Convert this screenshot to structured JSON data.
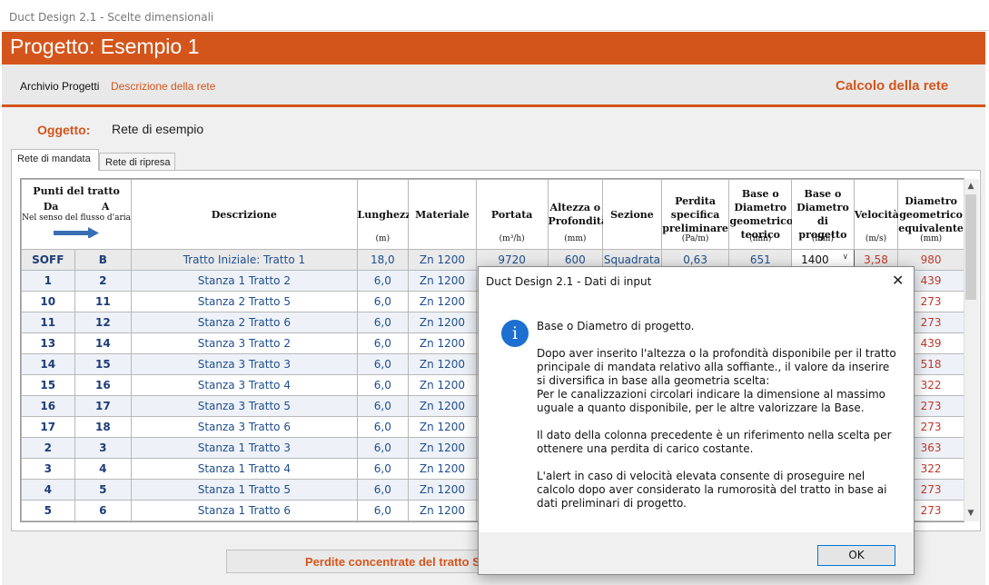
{
  "window": {
    "title": "Duct Design 2.1 - Scelte dimensionali"
  },
  "project": {
    "title": "Progetto: Esempio 1"
  },
  "menu": {
    "archivio": "Archivio Progetti",
    "descrizione": "Descrizione della rete",
    "calcolo": "Calcolo della rete"
  },
  "oggetto": {
    "label": "Oggetto:",
    "value": "Rete di esempio"
  },
  "tabs": [
    {
      "label": "Rete di mandata"
    },
    {
      "label": "Rete di ripresa"
    }
  ],
  "grid": {
    "headers": {
      "punti": "Punti del tratto",
      "da": "Da",
      "a": "A",
      "flusso": "Nel senso del flusso d'aria",
      "descrizione": "Descrizione",
      "lunghezza": "Lunghezza",
      "materiale": "Materiale",
      "portata": "Portata",
      "altezza_1": "Altezza o",
      "altezza_2": "Profondità",
      "sezione": "Sezione",
      "perdita_1": "Perdita",
      "perdita_2": "specifica",
      "perdita_3": "preliminare",
      "bdt_1": "Base o",
      "bdt_2": "Diametro",
      "bdt_3": "geometrico",
      "bdt_4": "teorico",
      "bdp_1": "Base o",
      "bdp_2": "Diametro",
      "bdp_3": "di progetto",
      "velocita": "Velocità",
      "deq_1": "Diametro",
      "deq_2": "geometrico",
      "deq_3": "equivalente"
    },
    "units": {
      "lunghezza": "(m)",
      "portata": "(m³/h)",
      "altezza": "(mm)",
      "perdita": "(Pa/m)",
      "bdt": "(mm)",
      "bdp": "(mm)",
      "velocita": "(m/s)",
      "deq": "(mm)"
    },
    "rows": [
      {
        "da": "SOFF",
        "a": "B",
        "descrizione": "Tratto Iniziale: Tratto 1",
        "lunghezza": "18,0",
        "materiale": "Zn 1200",
        "portata": "9720",
        "altezza": "600",
        "sezione": "Squadrata",
        "perdita": "0,63",
        "bdt": "651",
        "bdp": "1400",
        "velocita": "3,58",
        "deq": "980"
      },
      {
        "da": "1",
        "a": "2",
        "descrizione": "Stanza 1 Tratto 2",
        "lunghezza": "6,0",
        "materiale": "Zn 1200",
        "deq": "439"
      },
      {
        "da": "10",
        "a": "11",
        "descrizione": "Stanza 2 Tratto 5",
        "lunghezza": "6,0",
        "materiale": "Zn 1200",
        "deq": "273"
      },
      {
        "da": "11",
        "a": "12",
        "descrizione": "Stanza 2 Tratto 6",
        "lunghezza": "6,0",
        "materiale": "Zn 1200",
        "deq": "273"
      },
      {
        "da": "13",
        "a": "14",
        "descrizione": "Stanza 3 Tratto 2",
        "lunghezza": "6,0",
        "materiale": "Zn 1200",
        "deq": "439"
      },
      {
        "da": "14",
        "a": "15",
        "descrizione": "Stanza 3 Tratto 3",
        "lunghezza": "6,0",
        "materiale": "Zn 1200",
        "deq": "518"
      },
      {
        "da": "15",
        "a": "16",
        "descrizione": "Stanza 3 Tratto 4",
        "lunghezza": "6,0",
        "materiale": "Zn 1200",
        "deq": "322"
      },
      {
        "da": "16",
        "a": "17",
        "descrizione": "Stanza 3 Tratto 5",
        "lunghezza": "6,0",
        "materiale": "Zn 1200",
        "deq": "273"
      },
      {
        "da": "17",
        "a": "18",
        "descrizione": "Stanza 3 Tratto 6",
        "lunghezza": "6,0",
        "materiale": "Zn 1200",
        "deq": "273"
      },
      {
        "da": "2",
        "a": "3",
        "descrizione": "Stanza 1 Tratto 3",
        "lunghezza": "6,0",
        "materiale": "Zn 1200",
        "deq": "363"
      },
      {
        "da": "3",
        "a": "4",
        "descrizione": "Stanza 1 Tratto 4",
        "lunghezza": "6,0",
        "materiale": "Zn 1200",
        "deq": "322"
      },
      {
        "da": "4",
        "a": "5",
        "descrizione": "Stanza 1 Tratto 5",
        "lunghezza": "6,0",
        "materiale": "Zn 1200",
        "deq": "273"
      },
      {
        "da": "5",
        "a": "6",
        "descrizione": "Stanza 1 Tratto 6",
        "lunghezza": "6,0",
        "materiale": "Zn 1200",
        "deq": "273"
      }
    ]
  },
  "bottom_button": {
    "label": "Perdite concentrate del tratto S"
  },
  "dialog": {
    "title": "Duct Design 2.1 - Dati di input",
    "close": "✕",
    "icon": "info-icon",
    "heading": "Base o Diametro di progetto.",
    "p1": "Dopo aver inserito l'altezza o la profondità disponibile per il tratto principale di mandata relativo alla soffiante., il valore da inserire si diversifica in base alla geometria scelta:",
    "p1b": "Per le canalizzazioni circolari indicare la dimensione al massimo uguale a quanto disponibile, per le altre valorizzare la Base.",
    "p2": "Il dato della colonna precedente è un riferimento nella scelta per ottenere una perdita di carico costante.",
    "p3": "L'alert in caso di velocità elevata consente di proseguire nel calcolo dopo aver considerato la rumorosità del tratto in base ai dati preliminari di progetto.",
    "ok": "OK"
  }
}
